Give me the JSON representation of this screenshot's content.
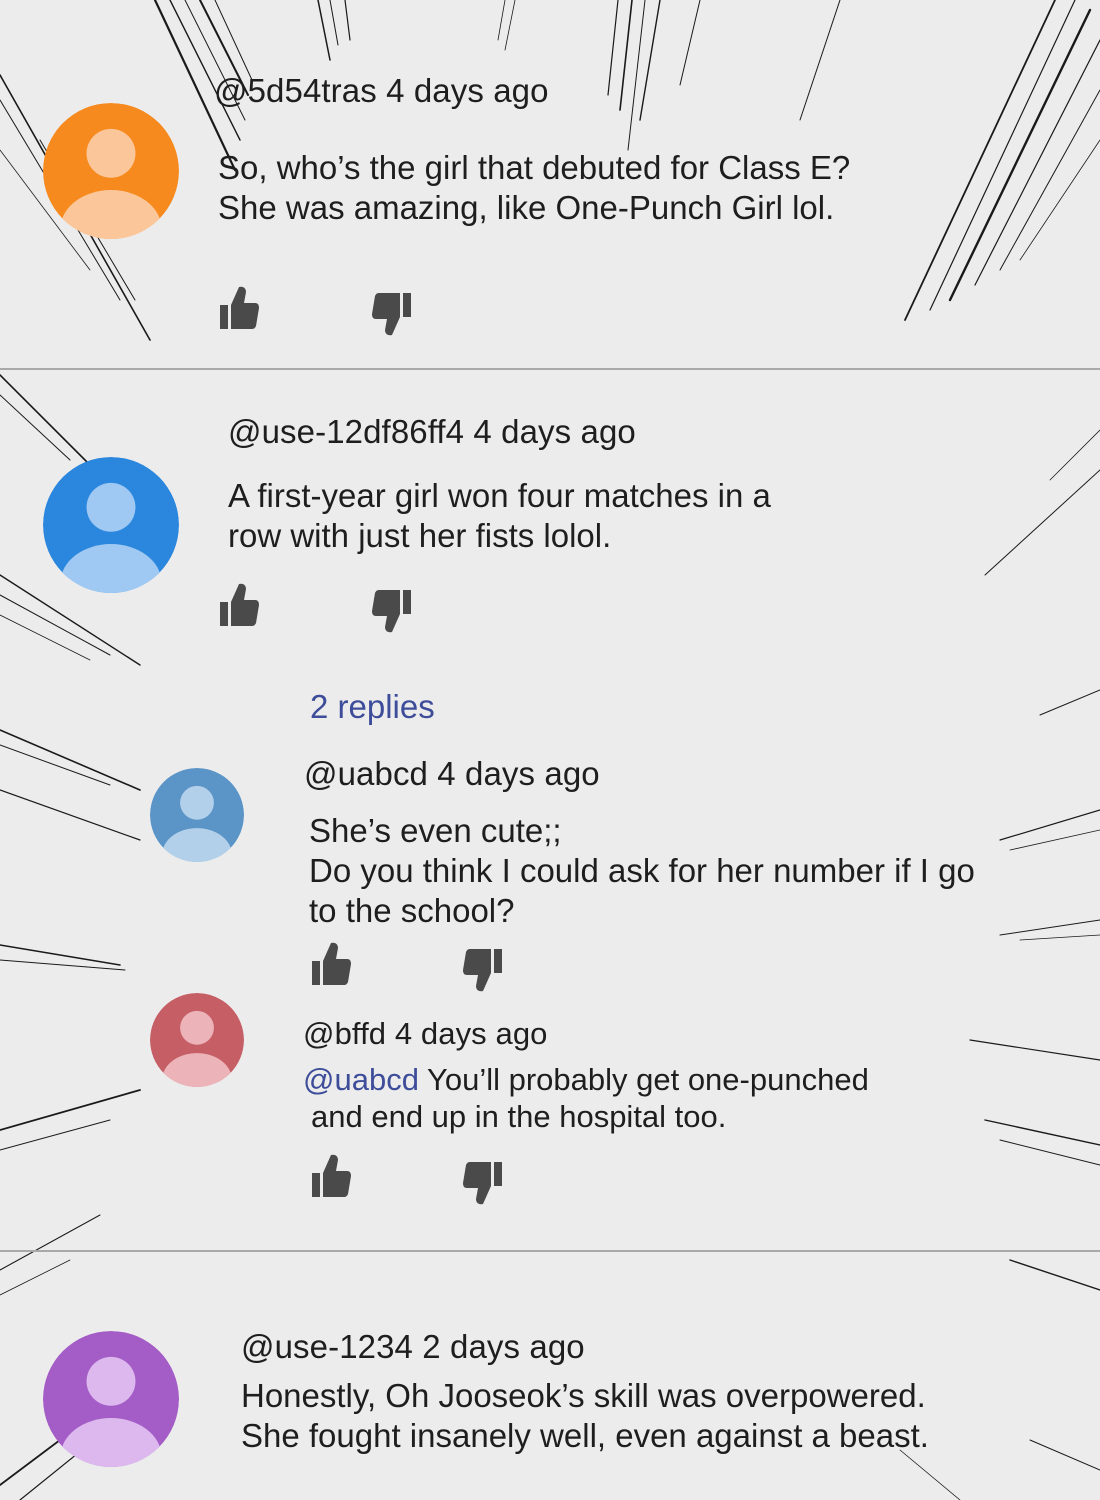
{
  "colors": {
    "background": "#ececec",
    "divider": "#a9a9a9",
    "text": "#1e1e1e",
    "link": "#3e4d9a",
    "icon": "#4a4a4a"
  },
  "comments": [
    {
      "avatar_color": "#f68a1e",
      "avatar_light": "#fbc79a",
      "username": "@5d54tras",
      "time": "4 days ago",
      "lines": [
        "So, who’s the girl that debuted for Class E?",
        "She was amazing, like One-Punch Girl lol."
      ]
    },
    {
      "avatar_color": "#2b87de",
      "avatar_light": "#9fc8f2",
      "username": "@use-12df86ff4",
      "time": "4 days ago",
      "lines": [
        "A first-year girl won four matches in a",
        "row with just her fists lolol."
      ],
      "replies_label": "2 replies",
      "replies": [
        {
          "avatar_color": "#5b94c7",
          "avatar_light": "#b2d0ea",
          "username": "@uabcd",
          "time": "4 days ago",
          "lines": [
            "She’s even cute;;",
            "Do you think I could ask for her number if I go",
            "to the school?"
          ]
        },
        {
          "avatar_color": "#c65e66",
          "avatar_light": "#ecb4b8",
          "username": "@bffd",
          "time": "4 days ago",
          "mention": "@uabcd",
          "lines": [
            "You’ll probably get one-punched",
            "and end up in the hospital too."
          ]
        }
      ]
    },
    {
      "avatar_color": "#a45cc6",
      "avatar_light": "#dcb8ee",
      "username": "@use-1234",
      "time": "2 days ago",
      "lines": [
        "Honestly, Oh Jooseok’s skill was overpowered.",
        "She fought insanely well, even against a beast."
      ]
    }
  ],
  "icons": {
    "like": "thumbs-up-icon",
    "dislike": "thumbs-down-icon",
    "avatar": "user-silhouette-icon"
  }
}
